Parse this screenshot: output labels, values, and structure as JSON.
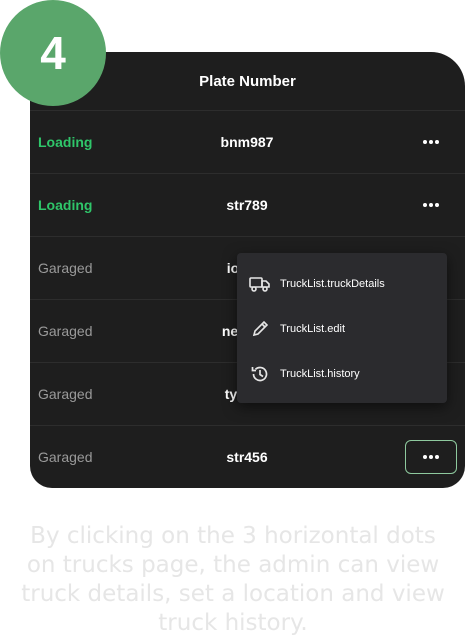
{
  "step_badge": "4",
  "table": {
    "header": "Plate Number",
    "rows": [
      {
        "status": "Loading",
        "plate": "bnm987"
      },
      {
        "status": "Loading",
        "plate": "str789"
      },
      {
        "status": "Garaged",
        "plate": "io"
      },
      {
        "status": "Garaged",
        "plate": "ne"
      },
      {
        "status": "Garaged",
        "plate": "ty"
      },
      {
        "status": "Garaged",
        "plate": "str456"
      }
    ]
  },
  "menu": {
    "items": [
      {
        "label": "TruckList.truckDetails",
        "icon": "truck-icon"
      },
      {
        "label": "TruckList.edit",
        "icon": "pencil-icon"
      },
      {
        "label": "TruckList.history",
        "icon": "history-icon"
      }
    ]
  },
  "caption": "By clicking on the 3 horizontal dots on trucks page, the admin can view truck details, set a location and view truck history.",
  "colors": {
    "accent_green": "#2fc66a",
    "badge_green": "#5aa66b",
    "background_dark": "#1e1e1e",
    "menu_bg": "#2b2b2e"
  }
}
